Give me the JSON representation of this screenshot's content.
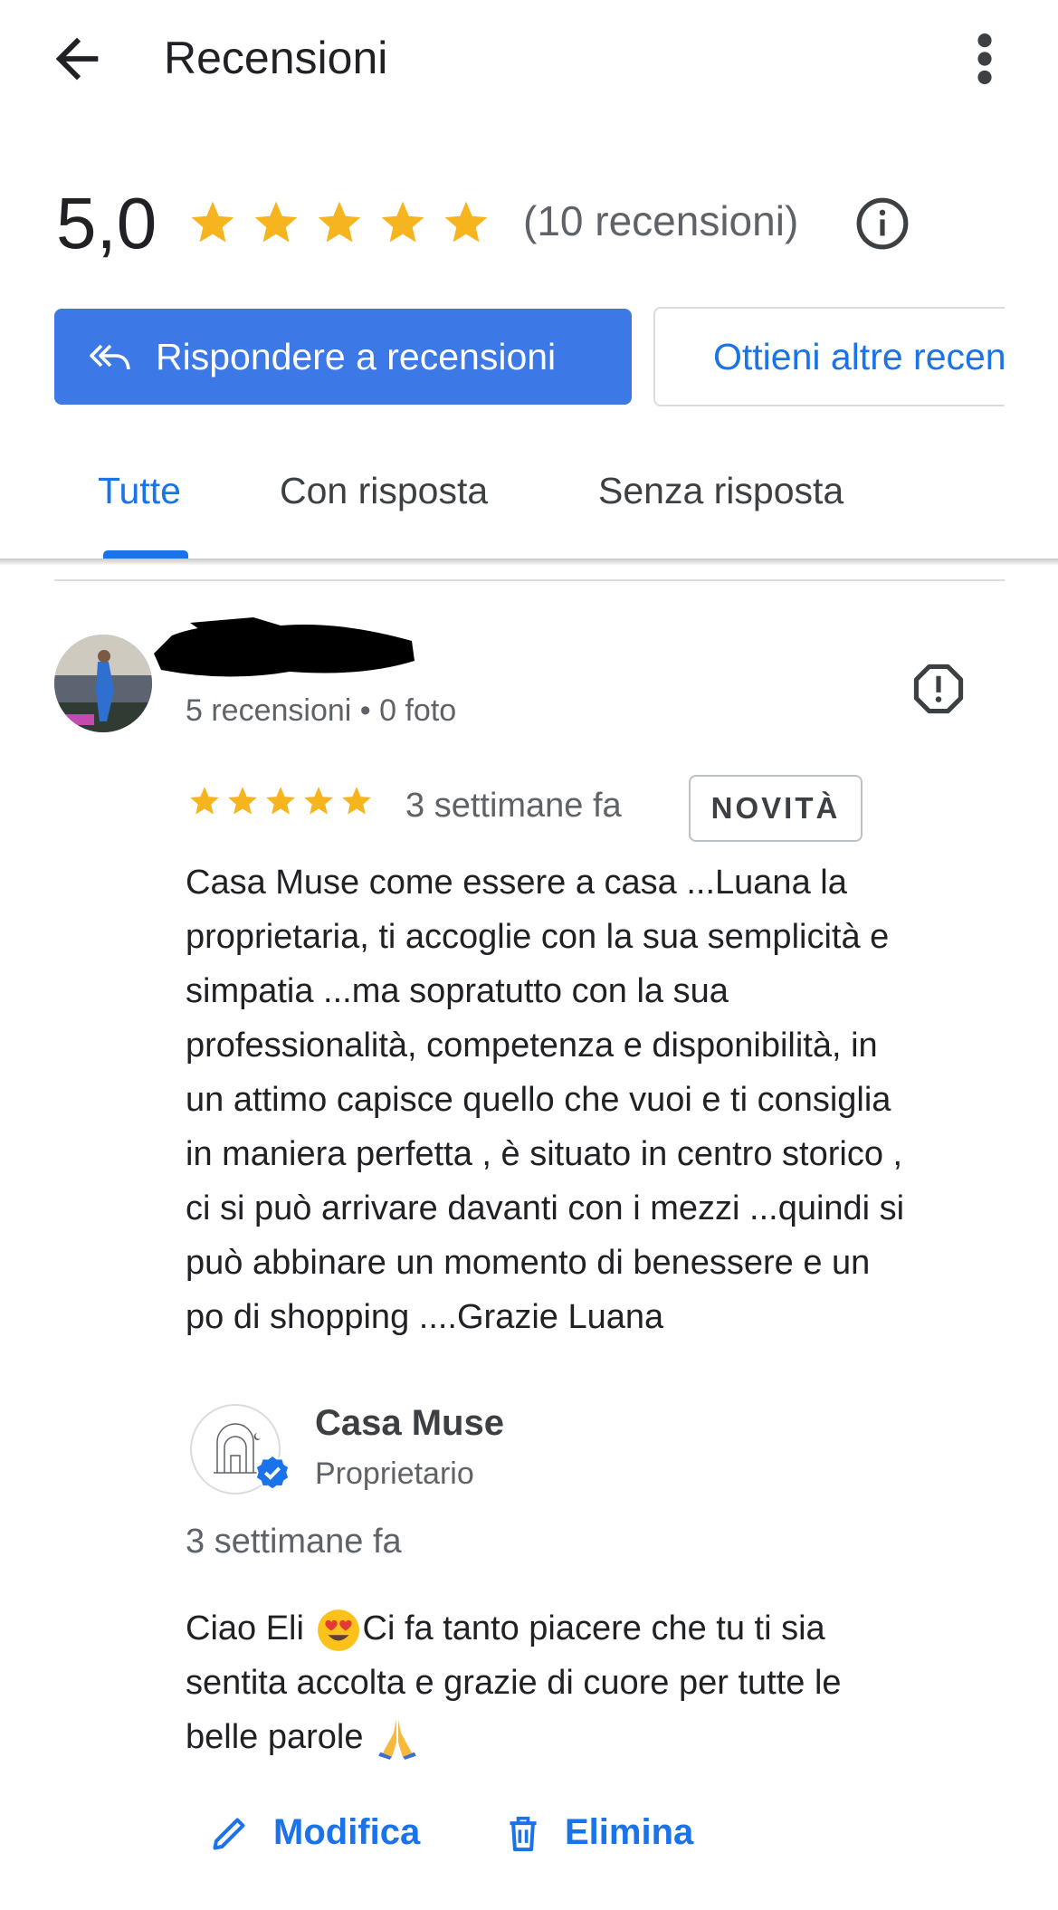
{
  "header": {
    "title": "Recensioni",
    "back_icon": "arrow-left-icon",
    "menu_icon": "more-vert-icon"
  },
  "summary": {
    "rating": "5,0",
    "stars": 5,
    "review_count": "(10 recensioni)",
    "info_icon": "info-icon",
    "star_color": "#f6b51e"
  },
  "actions": {
    "reply_label": "Rispondere a recensioni",
    "reply_icon": "reply-all-icon",
    "share_label": "Ottieni altre recensioni",
    "share_icon": "share-icon",
    "accent": "#3c79e6"
  },
  "tabs": [
    {
      "label": "Tutte",
      "selected": true
    },
    {
      "label": "Con risposta",
      "selected": false
    },
    {
      "label": "Senza risposta",
      "selected": false
    }
  ],
  "review": {
    "reviewer_meta": "5 recensioni • 0 foto",
    "stars": 5,
    "date": "3 settimane fa",
    "badge": "NOVITÀ",
    "text": "Casa Muse come essere a casa ...Luana la\nproprietaria, ti accoglie con la sua semplicità e\nsimpatia ...ma sopratutto con la sua\nprofessionalità, competenza e disponibilità, in\nun attimo capisce quello che vuoi e ti consiglia\nin maniera perfetta , è situato in centro storico ,\nci si può arrivare davanti con i mezzi ...quindi si\npuò abbinare un momento di benessere e un\npo di shopping ....Grazie Luana",
    "report_icon": "report-icon"
  },
  "owner_reply": {
    "name": "Casa Muse",
    "role": "Proprietario",
    "date": "3 settimane fa",
    "line1_a": "Ciao Eli ",
    "line1_b": "Ci fa tanto piacere che tu ti sia",
    "line2": "sentita accolta e grazie di cuore per tutte le",
    "line3": "belle parole ",
    "emoji_1": "heart-eyes-emoji",
    "emoji_2": "folded-hands-emoji"
  },
  "reply_actions": {
    "edit_label": "Modifica",
    "delete_label": "Elimina",
    "edit_icon": "pencil-icon",
    "delete_icon": "trash-icon"
  }
}
